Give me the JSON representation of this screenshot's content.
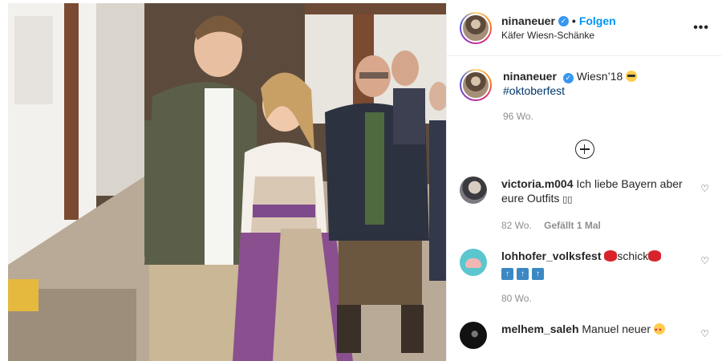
{
  "header": {
    "username": "ninaneuer",
    "separator": "•",
    "follow_label": "Folgen",
    "location": "Käfer Wiesn-Schänke",
    "more_icon": "more-options-icon"
  },
  "caption": {
    "username": "ninaneuer",
    "text": "Wiesn’18",
    "hashtag": "#oktoberfest",
    "time": "96 Wo."
  },
  "comments": [
    {
      "username": "victoria.m004",
      "text": "Ich liebe Bayern aber eure Outfits",
      "trailing": "▯▯",
      "time": "82 Wo.",
      "likes": "Gefällt 1 Mal"
    },
    {
      "username": "lohhofer_volksfest",
      "text": "schick",
      "time": "80 Wo."
    },
    {
      "username": "melhem_saleh",
      "text": "Manuel neuer"
    }
  ],
  "icons": {
    "verified": "verified-badge-icon",
    "load_more": "plus-circle-icon",
    "like": "heart-icon"
  }
}
